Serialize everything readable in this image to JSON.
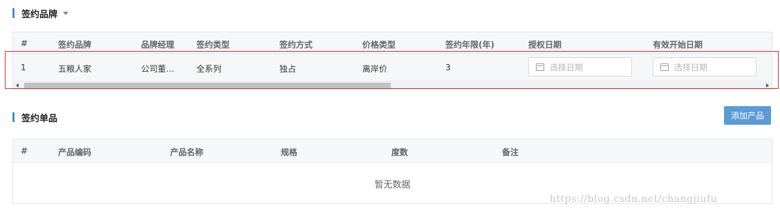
{
  "brand_section": {
    "title": "签约品牌",
    "columns": [
      "#",
      "签约品牌",
      "品牌经理",
      "签约类型",
      "签约方式",
      "价格类型",
      "签约年限(年)",
      "授权日期",
      "有效开始日期"
    ],
    "row": {
      "index": "1",
      "brand": "五粮人家",
      "manager": "公司董…",
      "sign_type": "全系列",
      "sign_method": "独占",
      "price_type": "离岸价",
      "years": "3",
      "auth_date_placeholder": "选择日期",
      "start_date_placeholder": "选择日期"
    }
  },
  "product_section": {
    "title": "签约单品",
    "add_button": "添加产品",
    "columns": [
      "#",
      "产品编码",
      "产品名称",
      "规格",
      "度数",
      "备注"
    ],
    "empty_text": "暂无数据"
  },
  "watermark": "https://blog.csdn.net/changjiufu",
  "colors": {
    "accent": "#3f8fd2",
    "button": "#5b9bd5",
    "highlight": "#d32f2f"
  }
}
